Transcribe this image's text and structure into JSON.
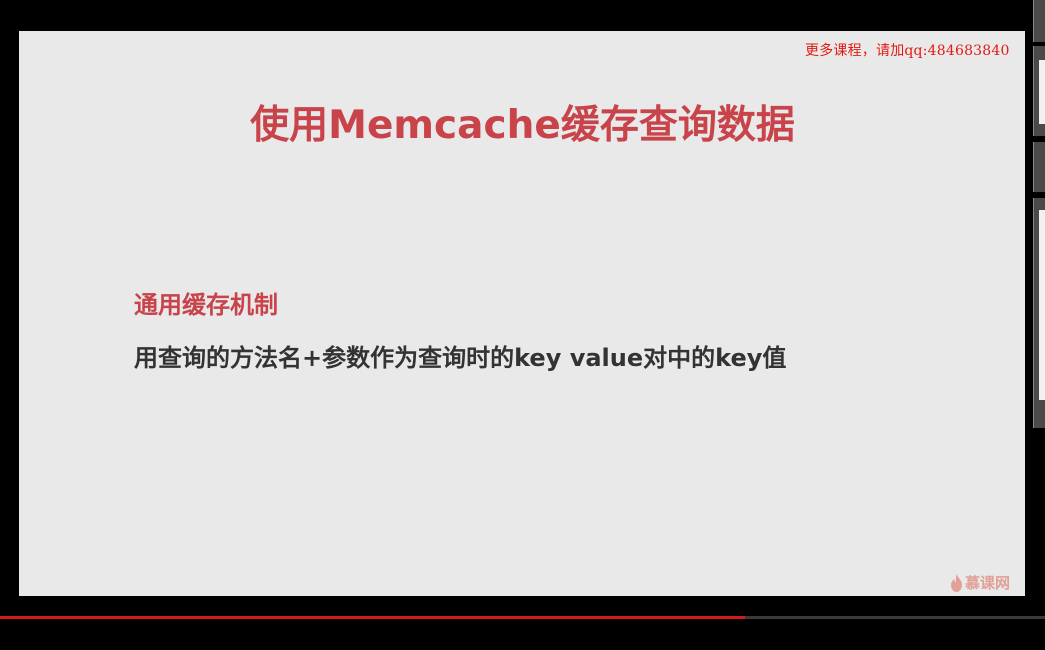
{
  "watermark": {
    "text": "更多课程，请加qq:484683840",
    "color": "#e21a12"
  },
  "slide": {
    "title": "使用Memcache缓存查询数据",
    "section": {
      "heading": "通用缓存机制",
      "body": "用查询的方法名+参数作为查询时的key value对中的key值"
    },
    "logo": {
      "icon": "flame-icon",
      "text": "慕课网"
    }
  },
  "player": {
    "progress_percent": 71.3,
    "progress_color": "#d11a1a"
  },
  "colors": {
    "title": "#c8434a",
    "body": "#333333",
    "slide_bg": "#e9e9e9"
  }
}
